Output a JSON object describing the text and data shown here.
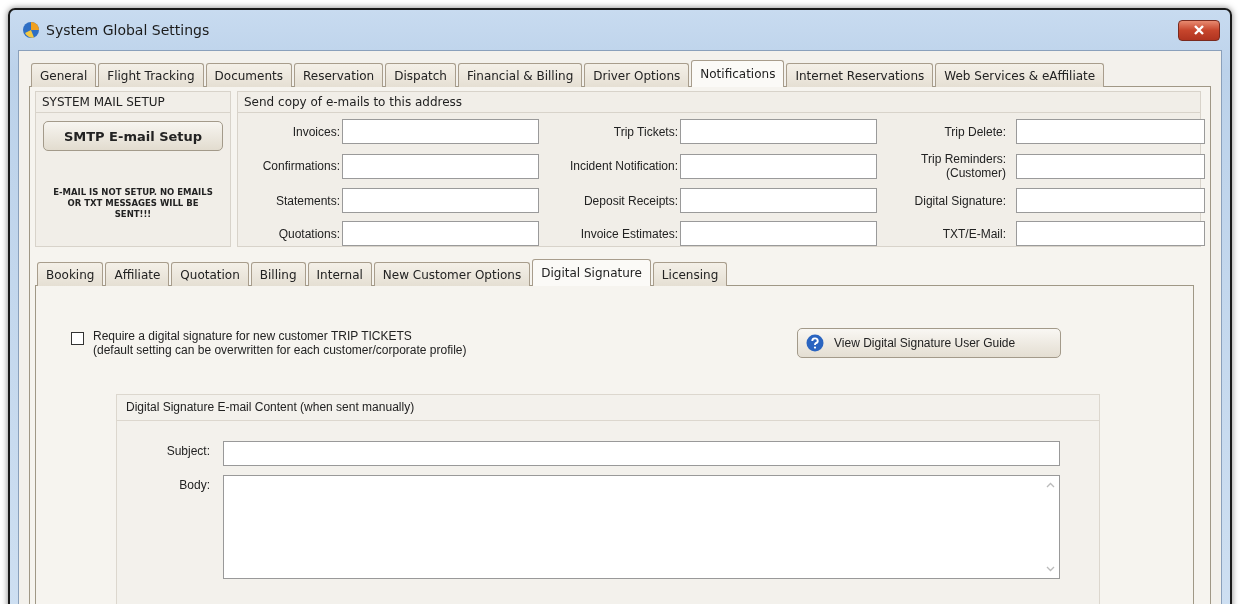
{
  "window": {
    "title": "System Global Settings"
  },
  "tabs": [
    {
      "label": "General",
      "selected": false
    },
    {
      "label": "Flight Tracking",
      "selected": false
    },
    {
      "label": "Documents",
      "selected": false
    },
    {
      "label": "Reservation",
      "selected": false
    },
    {
      "label": "Dispatch",
      "selected": false
    },
    {
      "label": "Financial & Billing",
      "selected": false
    },
    {
      "label": "Driver Options",
      "selected": false
    },
    {
      "label": "Notifications",
      "selected": true
    },
    {
      "label": "Internet Reservations",
      "selected": false
    },
    {
      "label": "Web Services & eAffiliate",
      "selected": false
    }
  ],
  "mail_setup": {
    "title": "SYSTEM MAIL SETUP",
    "button": "SMTP E-mail Setup",
    "warning": "E-MAIL IS NOT SETUP. NO EMAILS OR TXT MESSAGES WILL BE SENT!!!"
  },
  "copy_emails": {
    "title": "Send copy of e-mails to this address",
    "fields": [
      {
        "label": "Invoices:"
      },
      {
        "label": "Trip Tickets:"
      },
      {
        "label": "Trip Delete:"
      },
      {
        "label": "Confirmations:"
      },
      {
        "label": "Incident Notification:"
      },
      {
        "label": "Trip Reminders:\n(Customer)"
      },
      {
        "label": "Statements:"
      },
      {
        "label": "Deposit Receipts:"
      },
      {
        "label": "Digital Signature:"
      },
      {
        "label": "Quotations:"
      },
      {
        "label": "Invoice Estimates:"
      },
      {
        "label": "TXT/E-Mail:"
      }
    ]
  },
  "sub_tabs": [
    {
      "label": "Booking",
      "selected": false
    },
    {
      "label": "Affiliate",
      "selected": false
    },
    {
      "label": "Quotation",
      "selected": false
    },
    {
      "label": "Billing",
      "selected": false
    },
    {
      "label": "Internal",
      "selected": false
    },
    {
      "label": "New Customer Options",
      "selected": false
    },
    {
      "label": "Digital Signature",
      "selected": true
    },
    {
      "label": "Licensing",
      "selected": false
    }
  ],
  "require_signature": {
    "checked": false,
    "label": "Require a digital signature for new customer TRIP TICKETS",
    "note": "(default setting can be overwritten for each customer/corporate profile)"
  },
  "guide_button": {
    "label": "View Digital Signature User Guide"
  },
  "email_content": {
    "title": "Digital Signature E-mail Content (when sent manually)",
    "subject": {
      "label": "Subject:"
    },
    "body": {
      "label": "Body:"
    }
  }
}
